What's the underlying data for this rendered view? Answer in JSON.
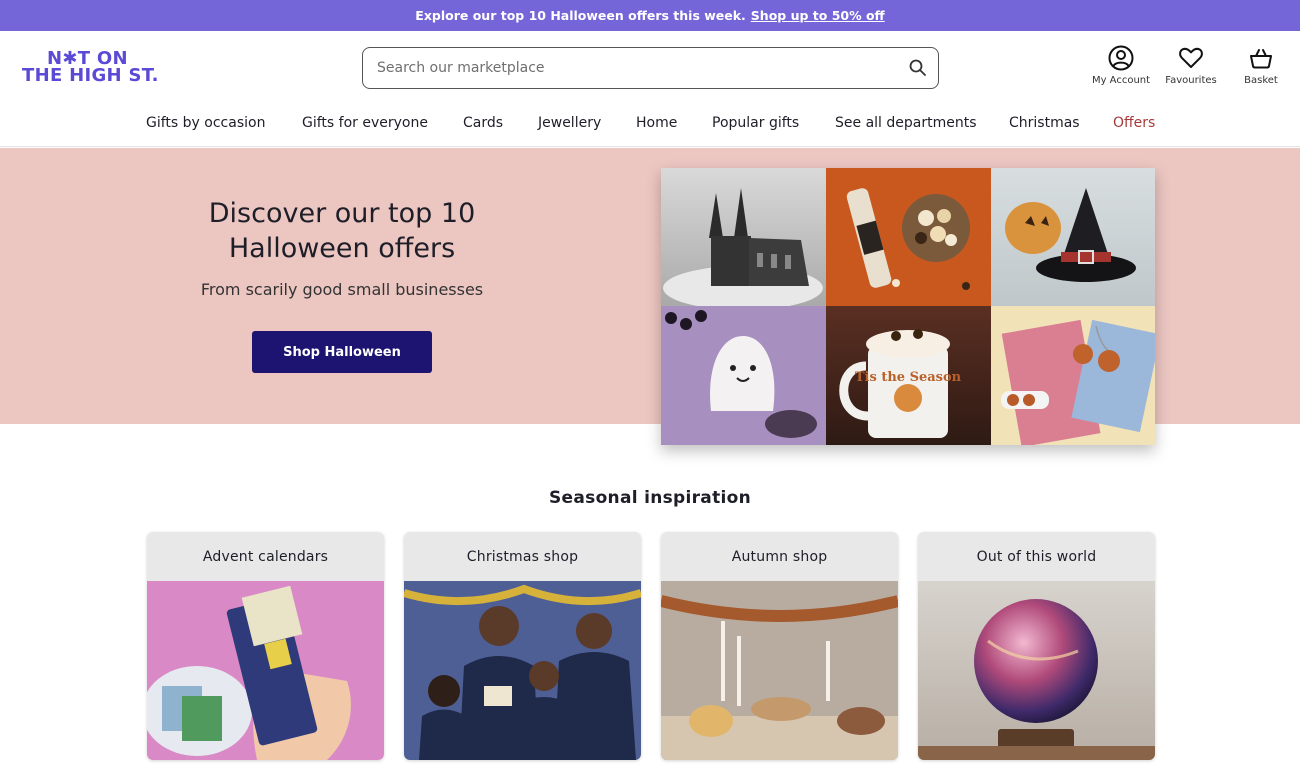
{
  "promo": {
    "text": "Explore our top 10 Halloween offers this week.",
    "link": "Shop up to 50% off"
  },
  "header": {
    "logo_line1": "N✱T ON",
    "logo_line2": "THE HIGH ST.",
    "search_placeholder": "Search our marketplace",
    "icons": {
      "account": "My Account",
      "favourites": "Favourites",
      "basket": "Basket"
    }
  },
  "nav": {
    "items": [
      "Gifts by occasion",
      "Gifts for everyone",
      "Cards",
      "Jewellery",
      "Home",
      "Popular gifts",
      "See all departments",
      "Christmas",
      "Offers"
    ]
  },
  "hero": {
    "title_line1": "Discover our top 10",
    "title_line2": "Halloween offers",
    "subtitle": "From scarily good small businesses",
    "button": "Shop Halloween",
    "collage_mug_text": "Tis the Season"
  },
  "seasonal": {
    "title": "Seasonal inspiration",
    "cards": [
      {
        "label": "Advent calendars"
      },
      {
        "label": "Christmas shop"
      },
      {
        "label": "Autumn shop"
      },
      {
        "label": "Out of this world"
      }
    ]
  },
  "colors": {
    "promo_bg": "#7466d9",
    "brand_purple": "#5b4ad6",
    "hero_bg": "#ecc6c1",
    "button_bg": "#1c1470",
    "offers_text": "#a63a3a"
  }
}
